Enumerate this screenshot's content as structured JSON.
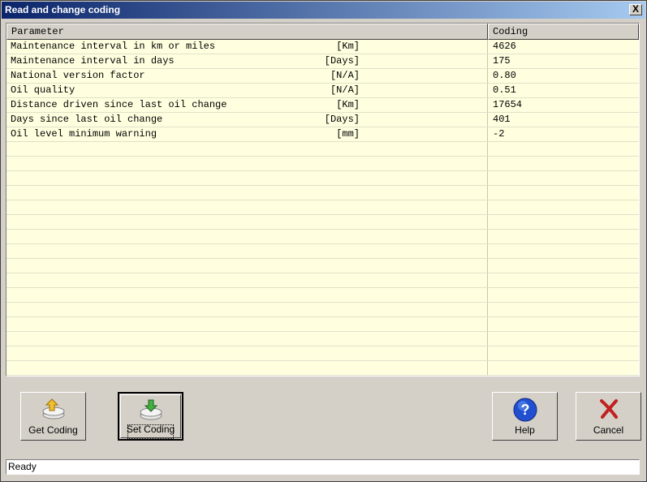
{
  "window": {
    "title": "Read and change coding",
    "close_label": "X"
  },
  "grid": {
    "headers": [
      "Parameter",
      "Coding"
    ],
    "rows": [
      {
        "param": "Maintenance interval in km or miles",
        "unit": "[Km]",
        "coding": "4626"
      },
      {
        "param": "Maintenance interval in days",
        "unit": "[Days]",
        "coding": "175"
      },
      {
        "param": "National version factor",
        "unit": "[N/A]",
        "coding": "0.80"
      },
      {
        "param": "Oil quality",
        "unit": "[N/A]",
        "coding": "0.51"
      },
      {
        "param": "Distance driven since last oil change",
        "unit": "[Km]",
        "coding": "17654"
      },
      {
        "param": "Days since last oil change",
        "unit": "[Days]",
        "coding": "401"
      },
      {
        "param": "Oil level minimum warning",
        "unit": "[mm]",
        "coding": "-2"
      }
    ],
    "empty_rows": 16
  },
  "buttons": {
    "get_coding": "Get Coding",
    "set_coding": "Set Coding",
    "help": "Help",
    "cancel": "Cancel"
  },
  "icons": {
    "get_coding": "drive-arrow-up-icon",
    "set_coding": "drive-arrow-down-icon",
    "help": "help-icon",
    "cancel": "cancel-x-icon"
  },
  "status": {
    "text": "Ready"
  }
}
